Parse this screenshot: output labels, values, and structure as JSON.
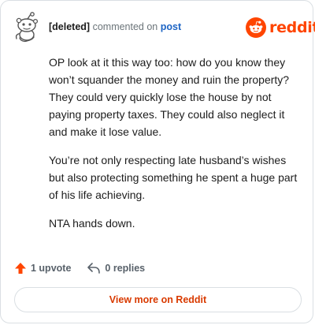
{
  "header": {
    "author": "[deleted]",
    "action": "commented on",
    "target": "post",
    "avatar_icon": "snoo-deleted-avatar-icon"
  },
  "brand": {
    "icon": "reddit-snoo-logo-icon",
    "wordmark": "reddit",
    "color": "#ff4500"
  },
  "comment": {
    "paragraphs": [
      "OP look at it this way too: how do you know they won’t squander the money and ruin the property? They could very quickly lose the house by not paying property taxes. They could also neglect it and make it lose value.",
      "You’re not only respecting late husband’s wishes but also protecting something he spent a huge part of his life achieving.",
      "NTA hands down."
    ]
  },
  "footer": {
    "upvote_icon": "upvote-arrow-icon",
    "upvote_label": "1 upvote",
    "reply_icon": "reply-arrow-icon",
    "reply_label": "0 replies"
  },
  "cta": {
    "label": "View more on Reddit"
  },
  "colors": {
    "accent": "#ff4500",
    "link": "#1d64c4",
    "cta_text": "#d93a00",
    "muted": "#6b7479"
  }
}
